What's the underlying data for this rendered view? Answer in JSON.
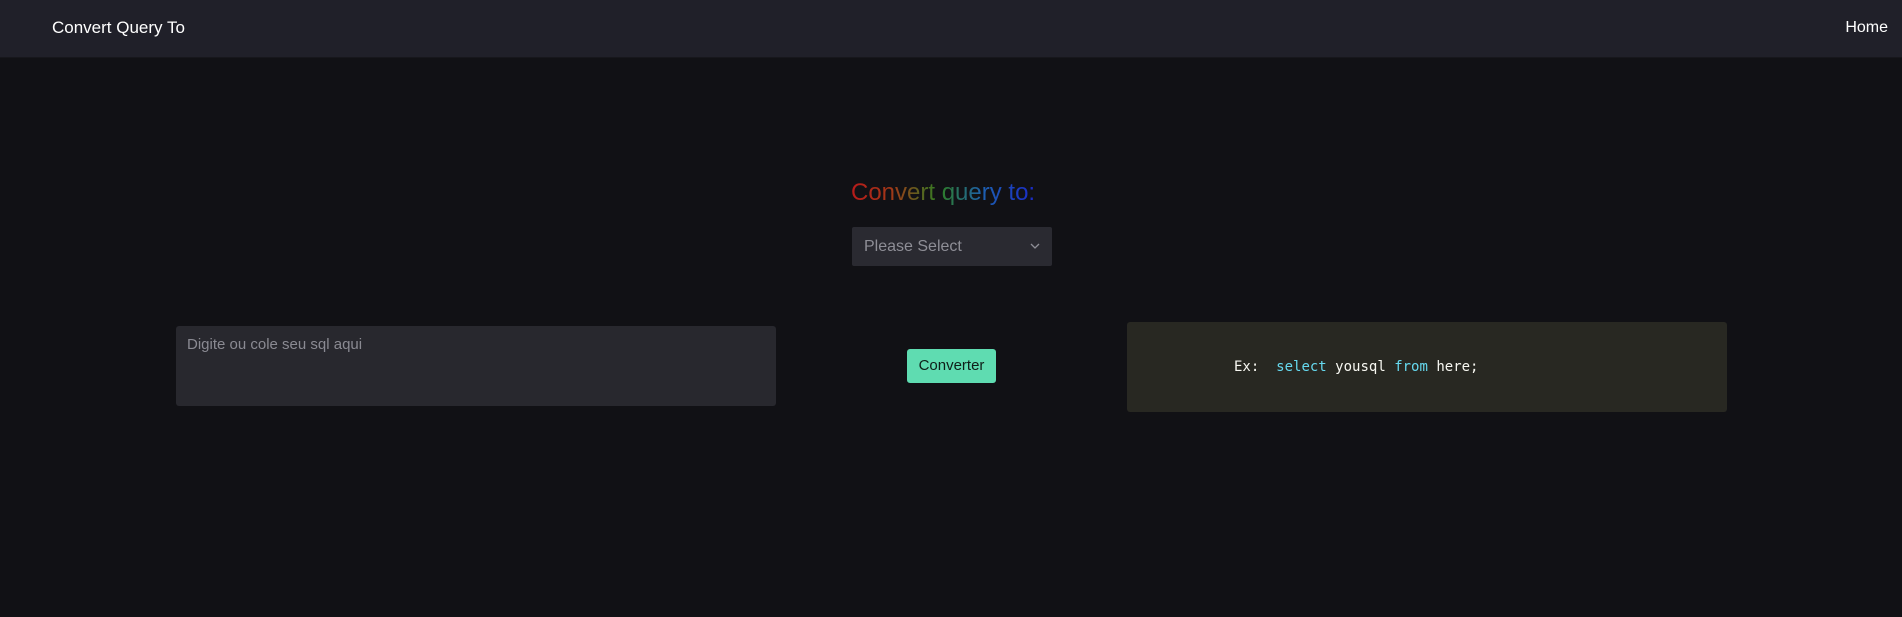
{
  "navbar": {
    "brand": "Convert Query To",
    "home_label": "Home"
  },
  "main": {
    "heading": "Convert query to:",
    "select": {
      "value": "Please Select"
    },
    "input": {
      "placeholder": "Digite ou cole seu sql aqui",
      "value": ""
    },
    "convert_button": "Converter",
    "output": {
      "prefix": "Ex:",
      "keyword_select": "select",
      "identifier": "yousql",
      "keyword_from": "from",
      "tail": "here;"
    }
  },
  "colors": {
    "background": "#111115",
    "navbar": "#202029",
    "button": "#5fdcb1",
    "output_panel": "#282822",
    "code_keyword": "#66d9ef"
  },
  "icons": {
    "select_arrow": "chevron-down-icon"
  }
}
